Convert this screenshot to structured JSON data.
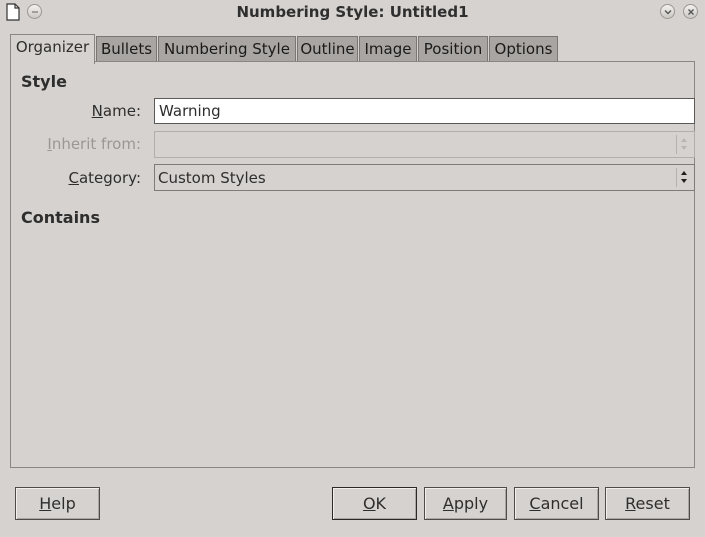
{
  "window": {
    "title": "Numbering Style: Untitled1"
  },
  "tabs": [
    {
      "label": "Organizer",
      "active": true
    },
    {
      "label": "Bullets",
      "active": false
    },
    {
      "label": "Numbering Style",
      "active": false
    },
    {
      "label": "Outline",
      "active": false
    },
    {
      "label": "Image",
      "active": false
    },
    {
      "label": "Position",
      "active": false
    },
    {
      "label": "Options",
      "active": false
    }
  ],
  "style_section": {
    "heading": "Style",
    "name": {
      "label_mnemonic": "N",
      "label_rest": "ame:",
      "value": "Warning"
    },
    "inherit_from": {
      "label_mnemonic": "I",
      "label_rest": "nherit from:",
      "value": "",
      "disabled": true
    },
    "category": {
      "label_mnemonic": "C",
      "label_rest": "ategory:",
      "value": "Custom Styles"
    }
  },
  "contains_section": {
    "heading": "Contains"
  },
  "buttons": {
    "help": {
      "mnemonic": "H",
      "rest": "elp"
    },
    "ok": {
      "mnemonic": "O",
      "rest": "K"
    },
    "apply": {
      "mnemonic": "A",
      "rest": "pply"
    },
    "cancel": {
      "mnemonic": "C",
      "rest": "ancel"
    },
    "reset": {
      "mnemonic": "R",
      "rest": "eset"
    }
  },
  "colors": {
    "background": "#d6d2cf",
    "inactive_tab": "#a9a5a2",
    "input_bg": "#ffffff"
  }
}
